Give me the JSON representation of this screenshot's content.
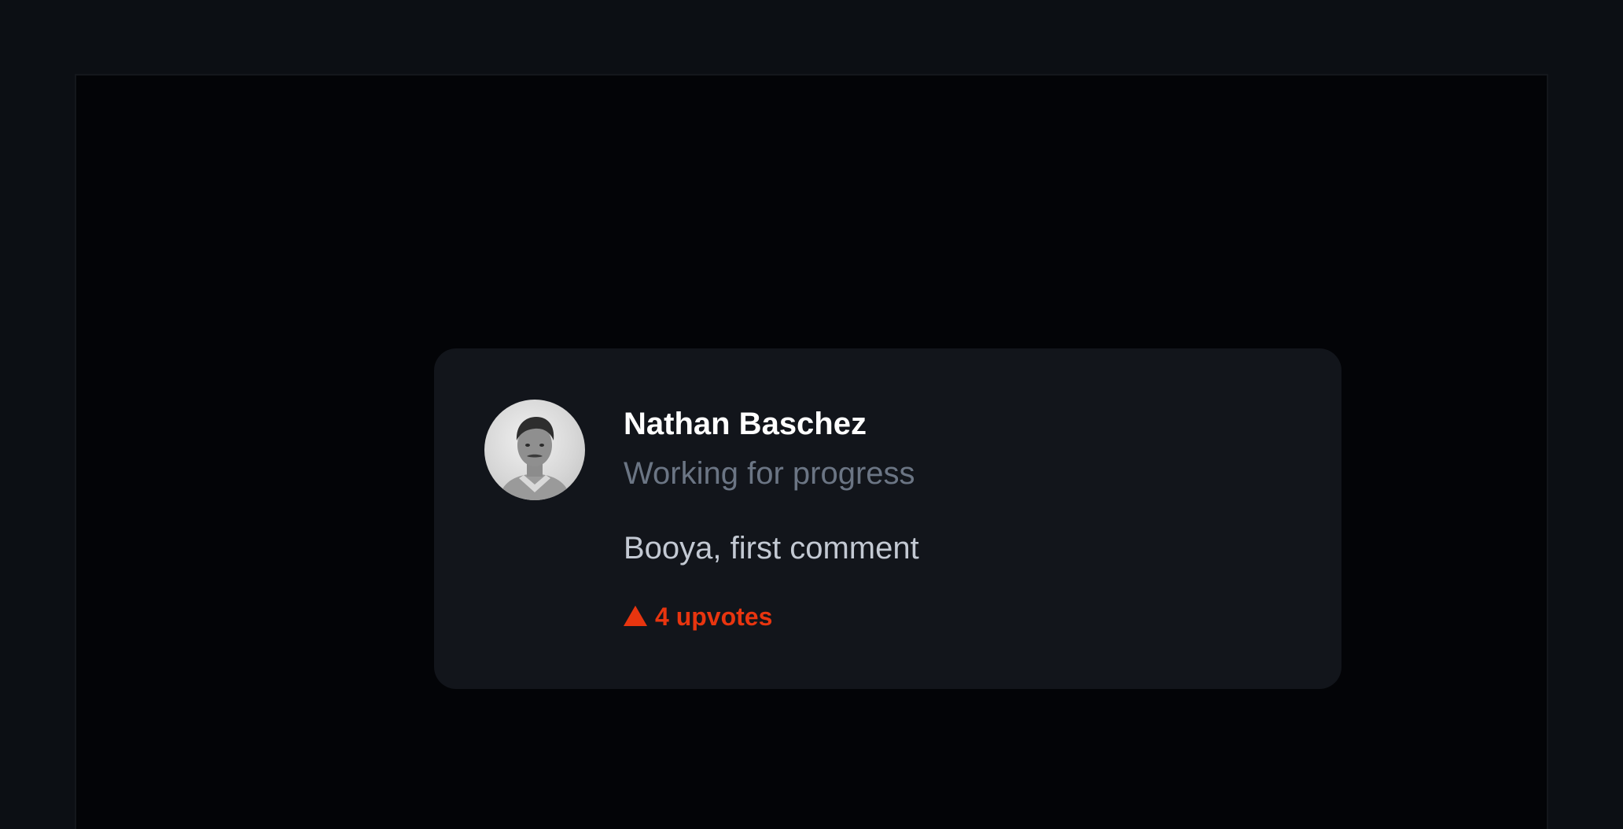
{
  "comment": {
    "author_name": "Nathan Baschez",
    "author_tagline": "Working for progress",
    "body": "Booya, first comment",
    "upvotes_label": "4 upvotes",
    "upvote_icon": "upvote-triangle-icon",
    "avatar_icon": "avatar-photo"
  },
  "colors": {
    "page_background": "#0c0f14",
    "frame_background": "#030407",
    "card_background": "#12151b",
    "name": "#ffffff",
    "tagline": "#6b7584",
    "body": "#c3c9d3",
    "accent": "#e8350f"
  }
}
